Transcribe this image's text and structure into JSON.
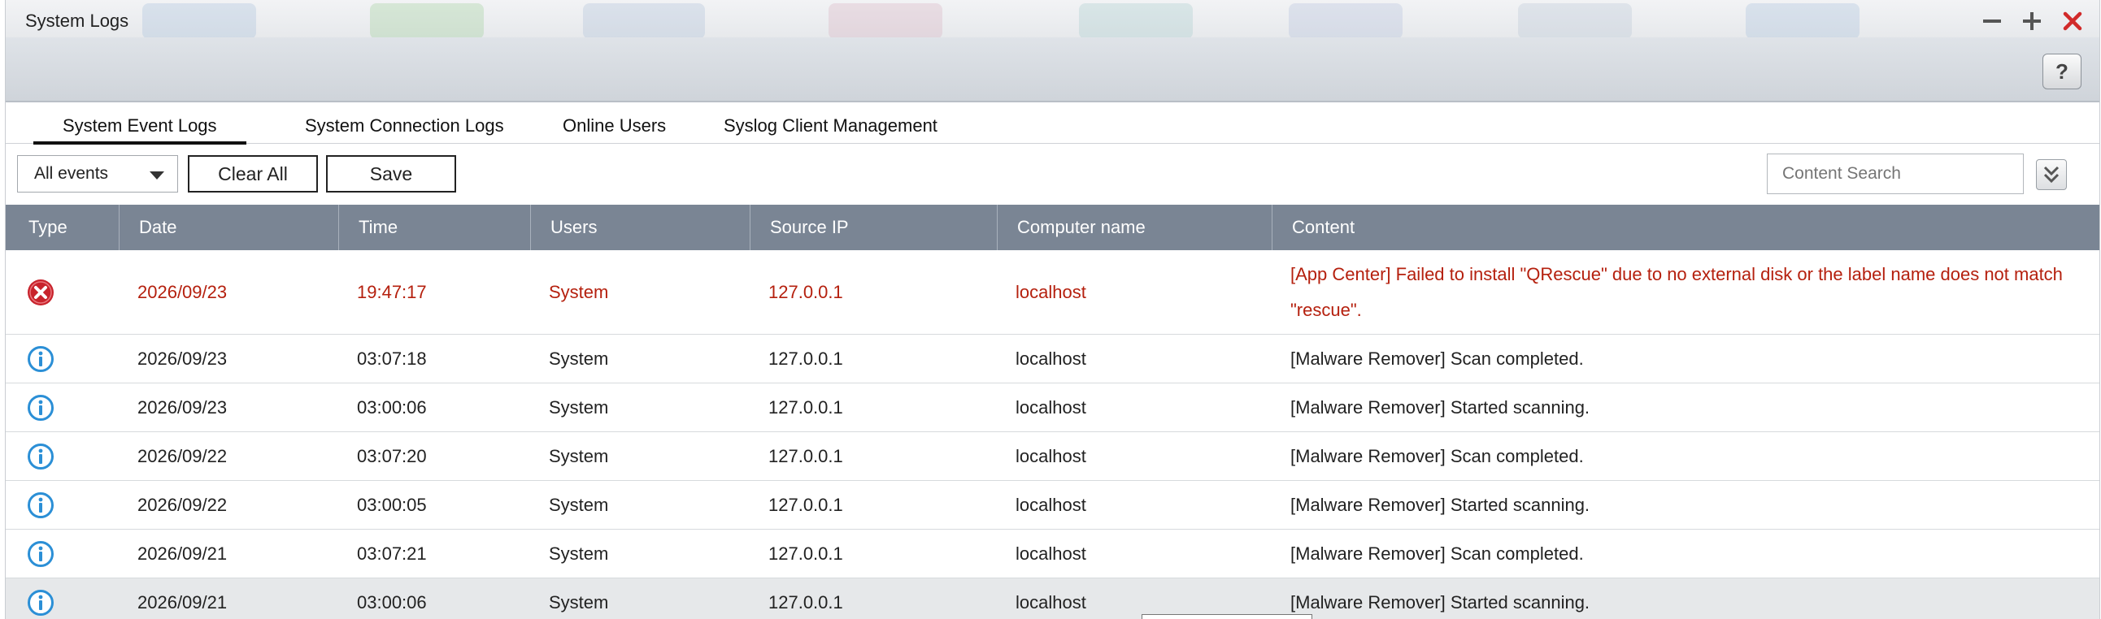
{
  "window": {
    "title": "System Logs",
    "controls": [
      "minimize-icon",
      "maximize-icon",
      "close-icon"
    ],
    "help_label": "?"
  },
  "tabs": [
    {
      "label": "System Event Logs",
      "active": true
    },
    {
      "label": "System Connection Logs",
      "active": false
    },
    {
      "label": "Online Users",
      "active": false
    },
    {
      "label": "Syslog Client Management",
      "active": false
    }
  ],
  "toolbar": {
    "filter_value": "All events",
    "clear_label": "Clear All",
    "save_label": "Save",
    "search_placeholder": "Content Search"
  },
  "table": {
    "columns": [
      "Type",
      "Date",
      "Time",
      "Users",
      "Source IP",
      "Computer name",
      "Content"
    ],
    "rows": [
      {
        "type": "error",
        "date": "2026/09/23",
        "time": "19:47:17",
        "user": "System",
        "ip": "127.0.0.1",
        "computer": "localhost",
        "content": "[App Center] Failed to install \"QRescue\" due to no external disk or the label name does not match \"rescue\"."
      },
      {
        "type": "info",
        "date": "2026/09/23",
        "time": "03:07:18",
        "user": "System",
        "ip": "127.0.0.1",
        "computer": "localhost",
        "content": "[Malware Remover] Scan completed."
      },
      {
        "type": "info",
        "date": "2026/09/23",
        "time": "03:00:06",
        "user": "System",
        "ip": "127.0.0.1",
        "computer": "localhost",
        "content": "[Malware Remover] Started scanning."
      },
      {
        "type": "info",
        "date": "2026/09/22",
        "time": "03:07:20",
        "user": "System",
        "ip": "127.0.0.1",
        "computer": "localhost",
        "content": "[Malware Remover] Scan completed."
      },
      {
        "type": "info",
        "date": "2026/09/22",
        "time": "03:00:05",
        "user": "System",
        "ip": "127.0.0.1",
        "computer": "localhost",
        "content": "[Malware Remover] Started scanning."
      },
      {
        "type": "info",
        "date": "2026/09/21",
        "time": "03:07:21",
        "user": "System",
        "ip": "127.0.0.1",
        "computer": "localhost",
        "content": "[Malware Remover] Scan completed."
      },
      {
        "type": "info",
        "date": "2026/09/21",
        "time": "03:00:06",
        "user": "System",
        "ip": "127.0.0.1",
        "computer": "localhost",
        "content": "[Malware Remover] Started scanning."
      }
    ]
  },
  "colors": {
    "error_text": "#b5200e",
    "error_icon": "#c8232c",
    "info_icon": "#2b8fd6",
    "header_bg": "#7a8594",
    "close_red": "#d12a2a"
  }
}
